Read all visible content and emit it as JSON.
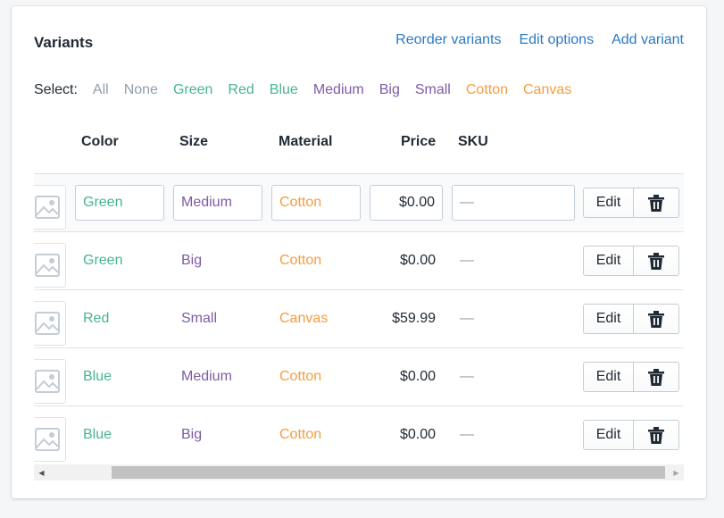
{
  "card": {
    "title": "Variants",
    "actions": [
      "Reorder variants",
      "Edit options",
      "Add variant"
    ]
  },
  "select": {
    "label": "Select:",
    "options": [
      {
        "label": "All",
        "color": "#919eab"
      },
      {
        "label": "None",
        "color": "#919eab"
      },
      {
        "label": "Green",
        "color": "#47b58d"
      },
      {
        "label": "Red",
        "color": "#47b58d"
      },
      {
        "label": "Blue",
        "color": "#47b58d"
      },
      {
        "label": "Medium",
        "color": "#7d5ba6"
      },
      {
        "label": "Big",
        "color": "#7d5ba6"
      },
      {
        "label": "Small",
        "color": "#7d5ba6"
      },
      {
        "label": "Cotton",
        "color": "#f49d3f"
      },
      {
        "label": "Canvas",
        "color": "#f49d3f"
      }
    ]
  },
  "table": {
    "columns": [
      "Color",
      "Size",
      "Material",
      "Price",
      "SKU"
    ],
    "rows": [
      {
        "color": "Green",
        "size": "Medium",
        "material": "Cotton",
        "price": "$0.00",
        "sku": "—",
        "editing": true
      },
      {
        "color": "Green",
        "size": "Big",
        "material": "Cotton",
        "price": "$0.00",
        "sku": "—"
      },
      {
        "color": "Red",
        "size": "Small",
        "material": "Canvas",
        "price": "$59.99",
        "sku": "—"
      },
      {
        "color": "Blue",
        "size": "Medium",
        "material": "Cotton",
        "price": "$0.00",
        "sku": "—"
      },
      {
        "color": "Blue",
        "size": "Big",
        "material": "Cotton",
        "price": "$0.00",
        "sku": "—"
      }
    ],
    "edit_label": "Edit",
    "delete_icon": "trash-icon",
    "thumbnail_icon": "image-placeholder-icon"
  },
  "scrollbar": {
    "left_arrow": "◀",
    "right_arrow": "▶"
  },
  "colors": {
    "link": "#2b78c5",
    "option_color": "#47b58d",
    "option_size": "#7d5ba6",
    "option_material": "#f49d3f"
  }
}
